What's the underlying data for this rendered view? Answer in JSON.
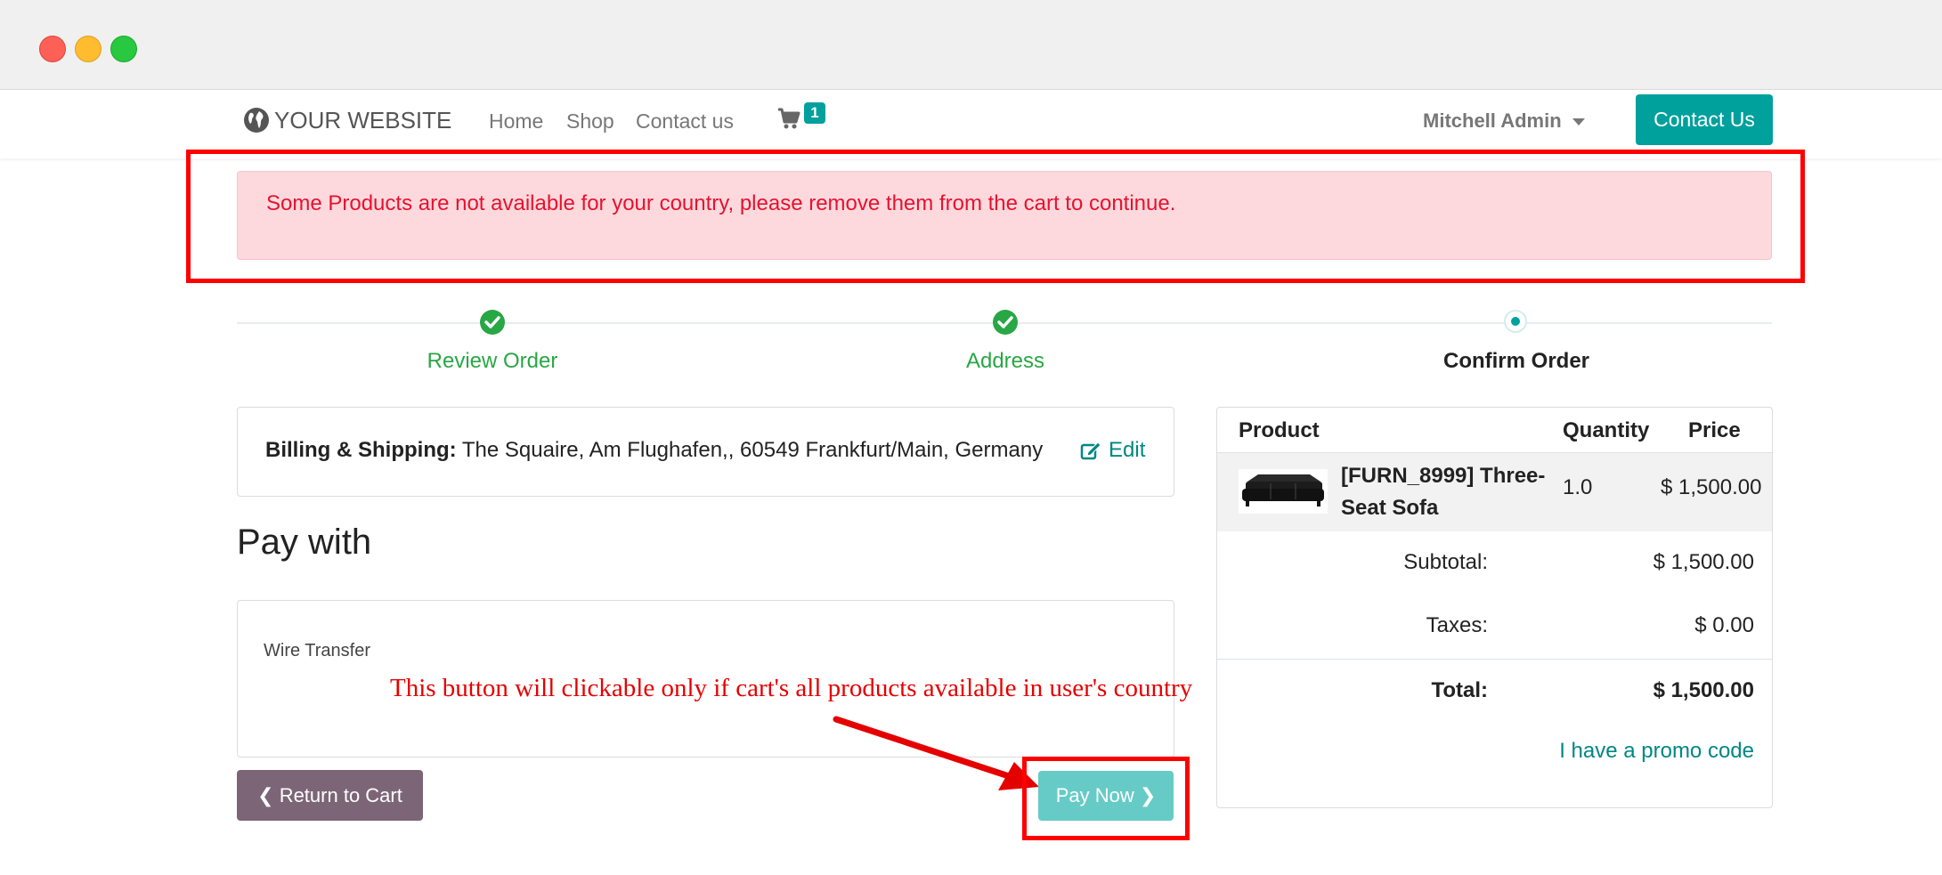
{
  "navbar": {
    "brand": "YOUR WEBSITE",
    "links": [
      "Home",
      "Shop",
      "Contact us"
    ],
    "cart_count": "1",
    "user": "Mitchell Admin",
    "contact_button": "Contact Us"
  },
  "alert": {
    "message": "Some Products are not available for your country, please remove them from the cart to continue."
  },
  "steps": [
    {
      "label": "Review Order",
      "state": "done"
    },
    {
      "label": "Address",
      "state": "done"
    },
    {
      "label": "Confirm Order",
      "state": "active"
    }
  ],
  "billing": {
    "label": "Billing & Shipping:",
    "address": "The Squaire, Am Flughafen,, 60549 Frankfurt/Main, Germany",
    "edit": "Edit"
  },
  "payment": {
    "title": "Pay with",
    "method": "Wire Transfer",
    "return_button": "Return to Cart",
    "pay_button": "Pay Now"
  },
  "annotation": "This button will clickable only if cart's all products available in user's country",
  "summary": {
    "headers": {
      "product": "Product",
      "quantity": "Quantity",
      "price": "Price"
    },
    "items": [
      {
        "name": "[FURN_8999] Three-Seat Sofa",
        "quantity": "1.0",
        "price": "$ 1,500.00"
      }
    ],
    "subtotal_label": "Subtotal:",
    "subtotal": "$ 1,500.00",
    "taxes_label": "Taxes:",
    "taxes": "$ 0.00",
    "total_label": "Total:",
    "total": "$ 1,500.00",
    "promo": "I have a promo code"
  },
  "colors": {
    "primary": "#00a09d",
    "success": "#28a745",
    "alert_bg": "#fdd9de",
    "alert_text": "#e8112d",
    "highlight": "#ff0000",
    "return_btn": "#7c6576",
    "pay_btn": "#66cbc6"
  }
}
